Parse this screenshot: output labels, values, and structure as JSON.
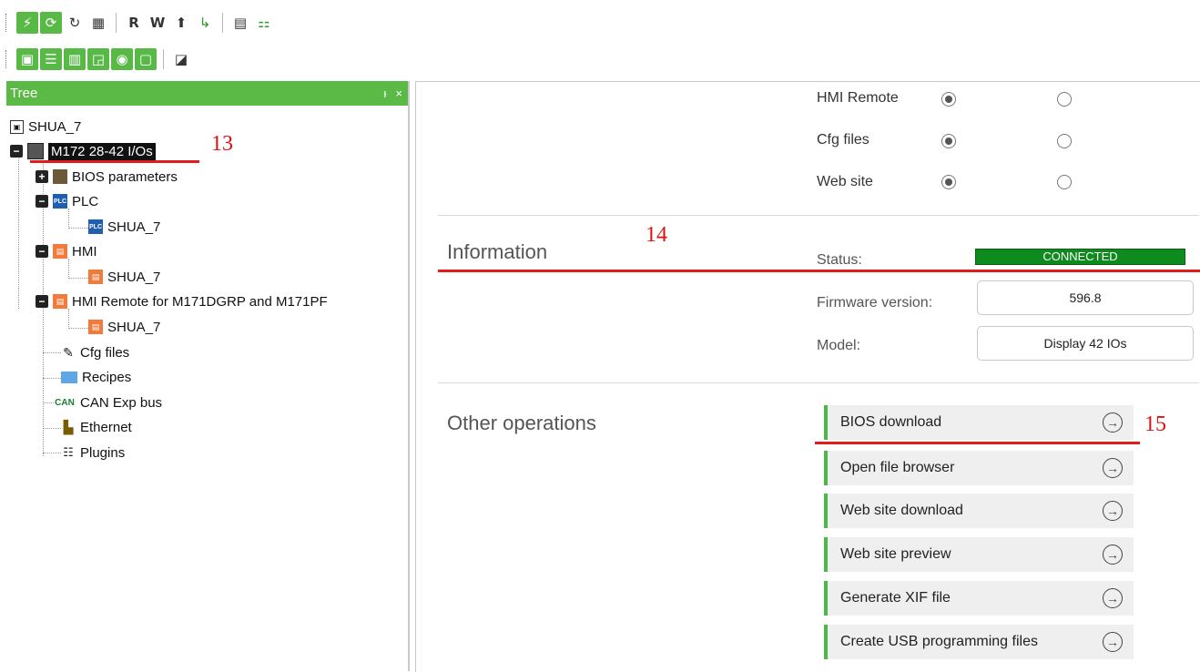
{
  "toolbar1": {
    "items": [
      {
        "icon": "plug-icon",
        "glyph": "⚡"
      },
      {
        "icon": "sync-icon",
        "glyph": "⟳"
      },
      {
        "icon": "refresh-icon",
        "glyph": "↻"
      },
      {
        "icon": "grid-icon",
        "glyph": "▦"
      },
      {
        "icon": "read-icon",
        "glyph": "R"
      },
      {
        "icon": "write-icon",
        "glyph": "W"
      },
      {
        "icon": "upload-icon",
        "glyph": "⬆"
      },
      {
        "icon": "download-device-icon",
        "glyph": "↳"
      },
      {
        "icon": "calendar-icon",
        "glyph": "▤"
      },
      {
        "icon": "network-icon",
        "glyph": "⚏"
      }
    ]
  },
  "toolbar2": {
    "items": [
      {
        "icon": "image-icon",
        "glyph": "▣"
      },
      {
        "icon": "tree-view-icon",
        "glyph": "☰"
      },
      {
        "icon": "panel-icon",
        "glyph": "▥"
      },
      {
        "icon": "chart-icon",
        "glyph": "◲"
      },
      {
        "icon": "watch-icon",
        "glyph": "◉"
      },
      {
        "icon": "monitor-icon",
        "glyph": "▢"
      },
      {
        "icon": "edit-window-icon",
        "glyph": "◪"
      }
    ]
  },
  "tree": {
    "title": "Tree",
    "pin_glyph": "ᵻ",
    "close_glyph": "×",
    "items": [
      {
        "label": "SHUA_7"
      },
      {
        "label": "M172 28-42 I/Os",
        "expander": "−"
      },
      {
        "label": "BIOS parameters",
        "expander": "+"
      },
      {
        "label": "PLC",
        "expander": "−",
        "icon_text": "PLC"
      },
      {
        "label": "SHUA_7",
        "icon_text": "PLC"
      },
      {
        "label": "HMI",
        "expander": "−"
      },
      {
        "label": "SHUA_7"
      },
      {
        "label": "HMI Remote for M171DGRP and M171PF",
        "expander": "−"
      },
      {
        "label": "SHUA_7"
      },
      {
        "label": "Cfg files"
      },
      {
        "label": "Recipes"
      },
      {
        "label": "CAN Exp bus",
        "icon_text": "CAN"
      },
      {
        "label": "Ethernet"
      },
      {
        "label": "Plugins"
      }
    ]
  },
  "annotations": [
    "13",
    "14",
    "15"
  ],
  "options": [
    {
      "label": "HMI Remote",
      "first_checked": true,
      "second_checked": false
    },
    {
      "label": "Cfg files",
      "first_checked": true,
      "second_checked": false
    },
    {
      "label": "Web site",
      "first_checked": true,
      "second_checked": false
    }
  ],
  "information": {
    "title": "Information",
    "status_label": "Status:",
    "status_value": "CONNECTED",
    "status_color": "#0f8a1e",
    "firmware_label": "Firmware version:",
    "firmware_value": "596.8",
    "model_label": "Model:",
    "model_value": "Display 42 IOs"
  },
  "other_operations": {
    "title": "Other operations",
    "buttons": [
      {
        "label": "BIOS download"
      },
      {
        "label": "Open file browser"
      },
      {
        "label": "Web site download"
      },
      {
        "label": "Web site preview"
      },
      {
        "label": "Generate XIF file"
      },
      {
        "label": "Create USB programming files"
      }
    ],
    "arrow_glyph": "→"
  },
  "colors": {
    "accent": "#5bb946",
    "annotation": "#e21b1b"
  }
}
